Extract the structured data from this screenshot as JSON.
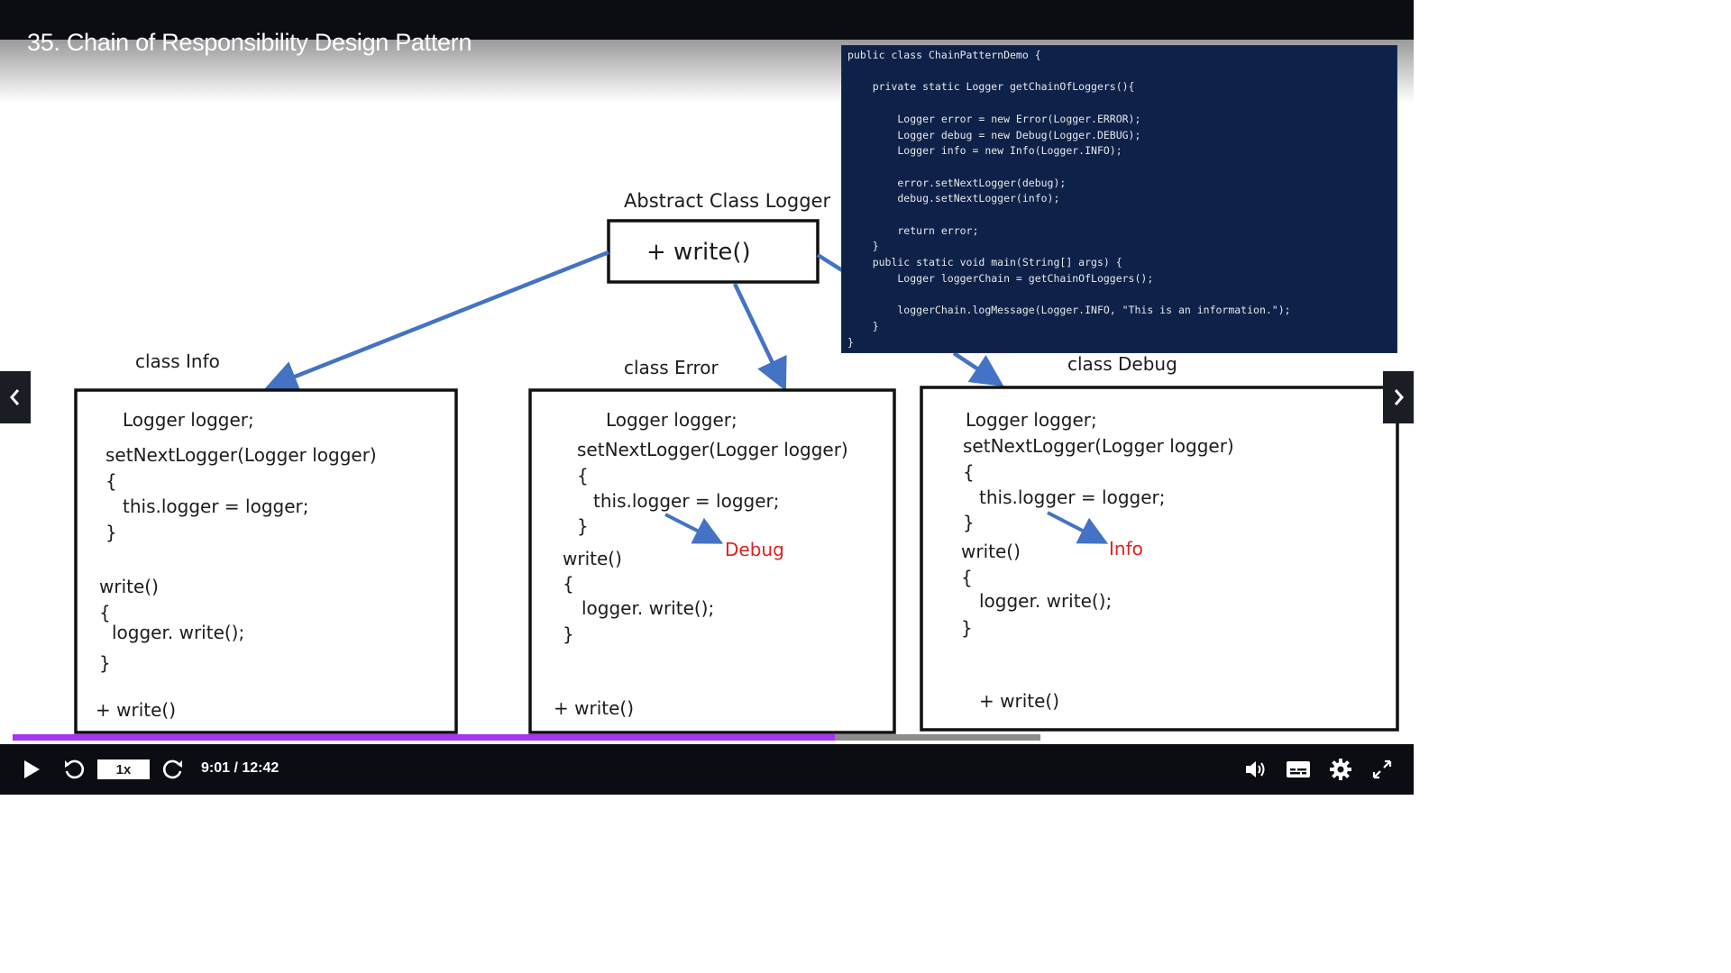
{
  "video": {
    "title": "35. Chain of Responsibility Design Pattern"
  },
  "diagram": {
    "abstract_label": "Abstract Class Logger",
    "abstract_method": "+ write()",
    "classes": [
      {
        "label": "class Info",
        "lines": [
          "Logger logger;",
          "setNextLogger(Logger logger)",
          "{",
          "this.logger = logger;",
          "}",
          "write()",
          "{",
          "logger. write();",
          "}",
          "+ write()"
        ]
      },
      {
        "label": "class Error",
        "lines": [
          "Logger logger;",
          "setNextLogger(Logger logger)",
          "{",
          "this.logger = logger;",
          "}",
          "write()",
          "{",
          "logger. write();",
          "}",
          "+ write()"
        ],
        "annotation": "Debug"
      },
      {
        "label": "class Debug",
        "lines": [
          "Logger logger;",
          "setNextLogger(Logger logger)",
          "{",
          "this.logger = logger;",
          "}",
          "write()",
          "{",
          "logger. write();",
          "}",
          "+ write()"
        ],
        "annotation": "Info"
      }
    ],
    "arrow_color": "#4472c4",
    "annotation_color": "#e02020"
  },
  "code": {
    "lines": [
      "public class ChainPatternDemo {",
      "",
      "    private static Logger getChainOfLoggers(){",
      "",
      "        Logger error = new Error(Logger.ERROR);",
      "        Logger debug = new Debug(Logger.DEBUG);",
      "        Logger info = new Info(Logger.INFO);",
      "",
      "        error.setNextLogger(debug);",
      "        debug.setNextLogger(info);",
      "",
      "        return error;",
      "    }",
      "    public static void main(String[] args) {",
      "        Logger loggerChain = getChainOfLoggers();",
      "",
      "        loggerChain.logMessage(Logger.INFO, \"This is an information.\");",
      "    }",
      "}"
    ],
    "background": "#0d2149"
  },
  "player": {
    "speed_label": "1x",
    "time_current": "9:01",
    "time_total": "12:42",
    "time_display": "9:01 / 12:42",
    "progress": 0.8,
    "accent": "#a435f0",
    "icons": {
      "play": "play-icon",
      "rewind": "rewind-icon",
      "forward": "forward-icon",
      "volume": "volume-icon",
      "captions": "captions-icon",
      "settings": "gear-icon",
      "fullscreen": "fullscreen-icon",
      "prev": "chevron-left-icon",
      "next": "chevron-right-icon"
    }
  }
}
